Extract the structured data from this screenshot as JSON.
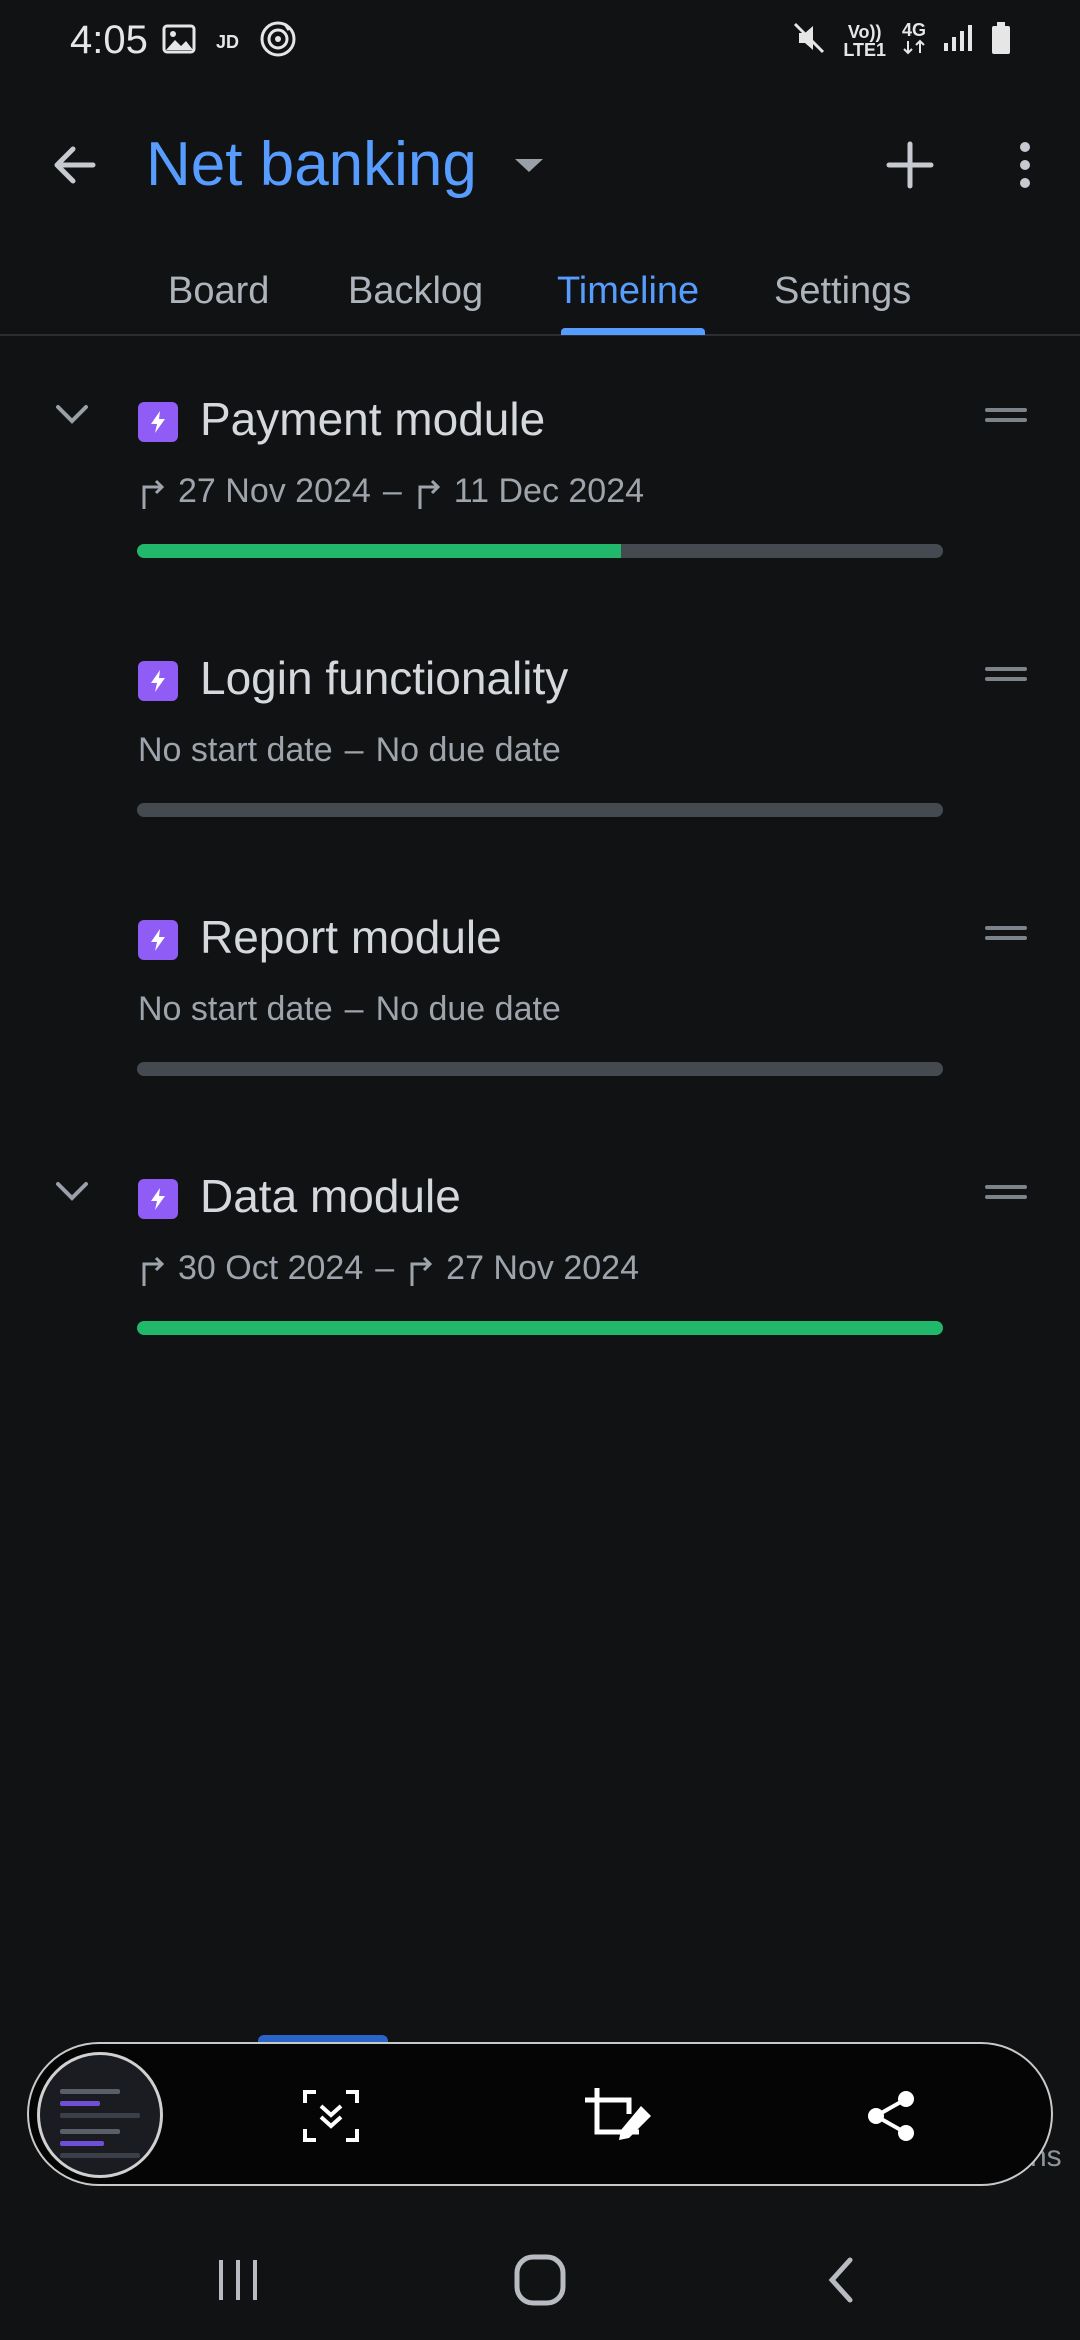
{
  "status_bar": {
    "time": "4:05",
    "jd_label": "JD",
    "volte_top": "Vo))",
    "volte_bottom": "LTE1",
    "network_label": "4G"
  },
  "app_bar": {
    "title": "Net banking"
  },
  "tabs": [
    {
      "label": "Board"
    },
    {
      "label": "Backlog"
    },
    {
      "label": "Timeline"
    },
    {
      "label": "Settings"
    }
  ],
  "active_tab": "Timeline",
  "epics": [
    {
      "name": "Payment module",
      "start": "27 Nov 2024",
      "end": "11 Dec 2024",
      "separator": "–",
      "progress": 0.6,
      "expanded": true
    },
    {
      "name": "Login functionality",
      "start": "No start date",
      "end": "No due date",
      "separator": "–",
      "progress": 0,
      "expanded": false
    },
    {
      "name": "Report module",
      "start": "No start date",
      "end": "No due date",
      "separator": "–",
      "progress": 0,
      "expanded": false
    },
    {
      "name": "Data module",
      "start": "30 Oct 2024",
      "end": "27 Nov 2024",
      "separator": "–",
      "progress": 1.0,
      "expanded": true
    }
  ],
  "colors": {
    "accent": "#579dff",
    "epic_icon": "#8f5cf6",
    "progress_done": "#22b86b",
    "progress_track": "#454a51",
    "background": "#111214"
  },
  "overlay": {
    "cut_off_text": "ns"
  }
}
